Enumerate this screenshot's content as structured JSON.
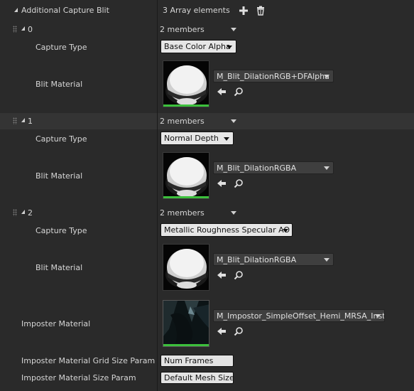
{
  "header": {
    "property_label": "Additional Capture Blit",
    "array_summary": "3 Array elements",
    "add_icon": "plus-icon",
    "delete_icon": "trash-icon"
  },
  "elements": [
    {
      "index": "0",
      "members": "2 members",
      "capture_type_label": "Capture Type",
      "capture_type_value": "Base Color Alpha",
      "blit_material_label": "Blit Material",
      "blit_material_value": "M_Blit_DilationRGB+DFAlpha"
    },
    {
      "index": "1",
      "members": "2 members",
      "capture_type_label": "Capture Type",
      "capture_type_value": "Normal Depth",
      "blit_material_label": "Blit Material",
      "blit_material_value": "M_Blit_DilationRGBA"
    },
    {
      "index": "2",
      "members": "2 members",
      "capture_type_label": "Capture Type",
      "capture_type_value": "Metallic Roughness Specular AO",
      "blit_material_label": "Blit Material",
      "blit_material_value": "M_Blit_DilationRGBA"
    }
  ],
  "imposter_material": {
    "label": "Imposter Material",
    "value": "M_Impostor_SimpleOffset_Hemi_MRSA_Inst"
  },
  "grid_size_param": {
    "label": "Imposter Material Grid Size Param",
    "value": "Num Frames"
  },
  "size_param": {
    "label": "Imposter Material Size Param",
    "value": "Default Mesh Size"
  },
  "colors": {
    "background": "#282828",
    "alt_row": "#343434",
    "thumbnail_border_active": "#3cc03c"
  }
}
